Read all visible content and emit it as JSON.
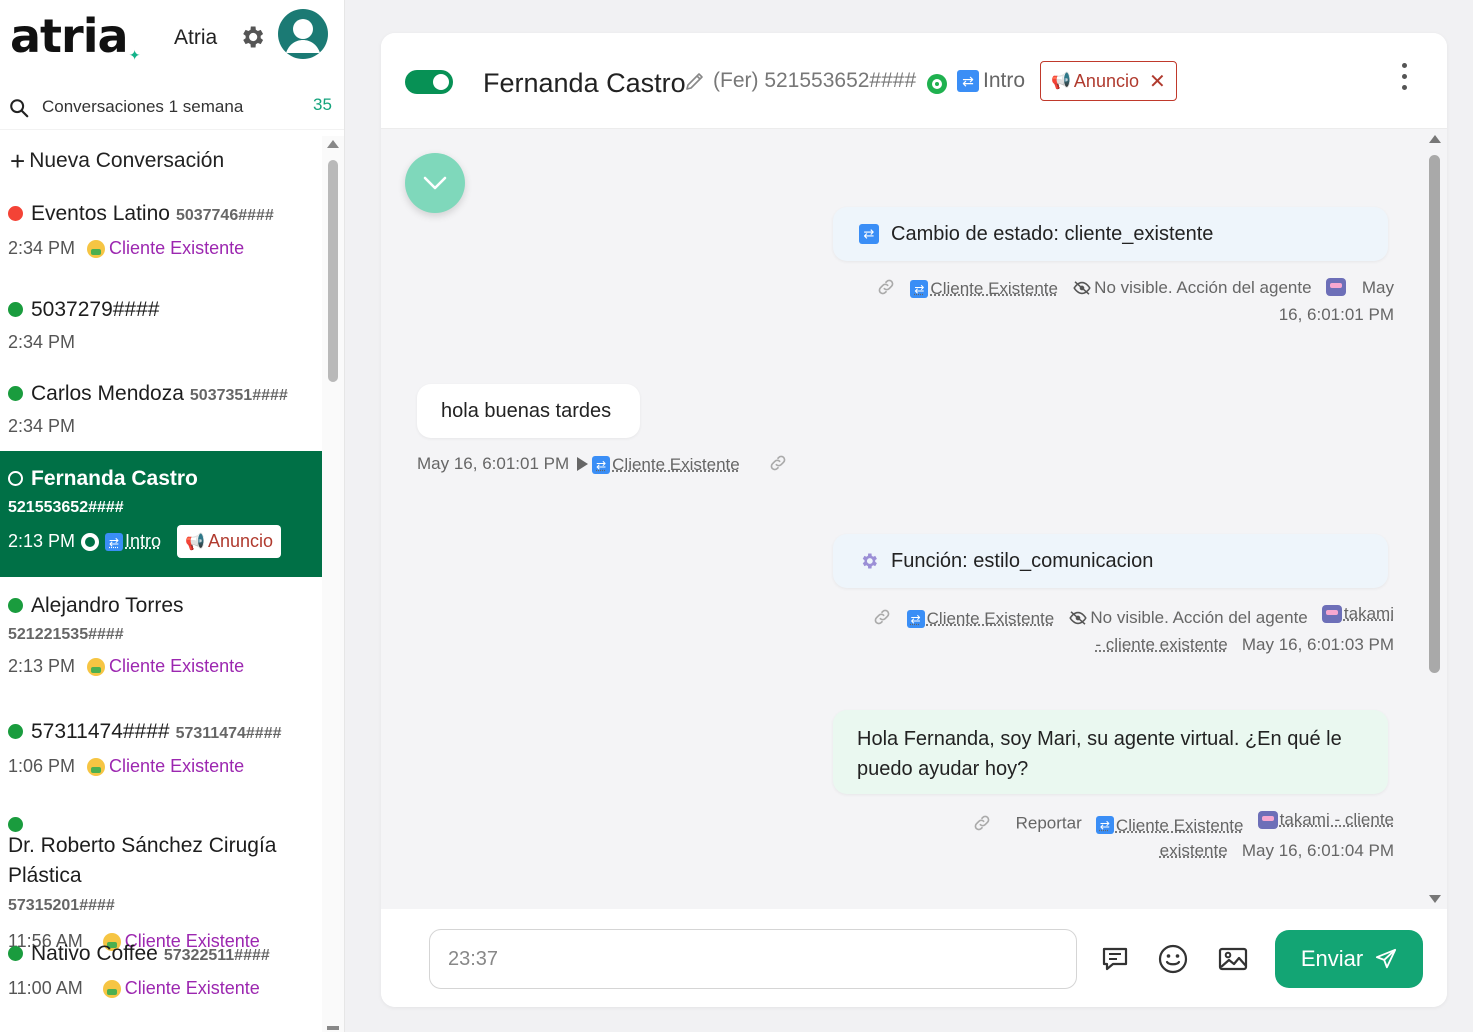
{
  "app": {
    "logo": "atria",
    "name": "Atria"
  },
  "search": {
    "label": "Conversaciones 1 semana",
    "count": "35"
  },
  "sidebar": {
    "new_conversation": "Nueva Conversación",
    "conversations": [
      {
        "name": "Eventos Latino",
        "number": "5037746####",
        "time": "2:34 PM",
        "tag": "Cliente Existente",
        "status_color": "#f44336"
      },
      {
        "name": "5037279####",
        "number": "",
        "time": "2:34 PM",
        "tag": "",
        "status_color": "#1a9c3e"
      },
      {
        "name": "Carlos Mendoza",
        "number": "5037351####",
        "time": "2:34 PM",
        "tag": "",
        "status_color": "#1a9c3e"
      },
      {
        "name": "Fernanda Castro",
        "number": "521553652####",
        "time": "2:13 PM",
        "stage": "Intro",
        "badge": "Anuncio",
        "active": true
      },
      {
        "name": "Alejandro Torres",
        "number": "521221535####",
        "time": "2:13 PM",
        "tag": "Cliente Existente",
        "status_color": "#1a9c3e"
      },
      {
        "name": "57311474####",
        "number": "57311474####",
        "time": "1:06 PM",
        "tag": "Cliente Existente",
        "status_color": "#1a9c3e"
      },
      {
        "name": "Dr. Roberto Sánchez Cirugía Plástica",
        "number": "57315201####",
        "time": "11:56 AM",
        "tag": "Cliente Existente",
        "status_color": "#1a9c3e"
      },
      {
        "name": "Nativo Coffee",
        "number": "57322511####",
        "time": "11:00 AM",
        "tag": "Cliente Existente",
        "status_color": "#1a9c3e"
      }
    ]
  },
  "header": {
    "contact_name": "Fernanda Castro",
    "nickname_phone": "(Fer) 521553652####",
    "stage": "Intro",
    "badge": "Anuncio",
    "toggle_on": true
  },
  "messages": {
    "status_change": {
      "text": "Cambio de estado: cliente_existente",
      "stage": "Cliente Existente",
      "visibility": "No visible. Acción del agente",
      "time_a": "May",
      "time_b": "16, 6:01:01 PM"
    },
    "incoming": {
      "text": "hola buenas tardes",
      "time": "May 16, 6:01:01 PM",
      "stage": "Cliente Existente"
    },
    "function_call": {
      "text": "Función: estilo_comunicacion",
      "stage": "Cliente Existente",
      "visibility": "No visible. Acción del agente",
      "agent_a": "takami",
      "agent_b": "- cliente existente",
      "time": "May 16, 6:01:03 PM"
    },
    "outgoing": {
      "text": "Hola Fernanda, soy Mari, su agente virtual. ¿En qué le puedo ayudar hoy?",
      "report": "Reportar",
      "stage": "Cliente Existente",
      "agent_a": "takami - cliente",
      "agent_b": "existente",
      "time": "May 16, 6:01:04 PM"
    }
  },
  "composer": {
    "placeholder": "23:37",
    "send_label": "Enviar"
  },
  "colors": {
    "brand_green": "#007046",
    "accent": "#13a574",
    "tag_purple": "#9c27b0",
    "badge_red": "#b03a2e"
  }
}
